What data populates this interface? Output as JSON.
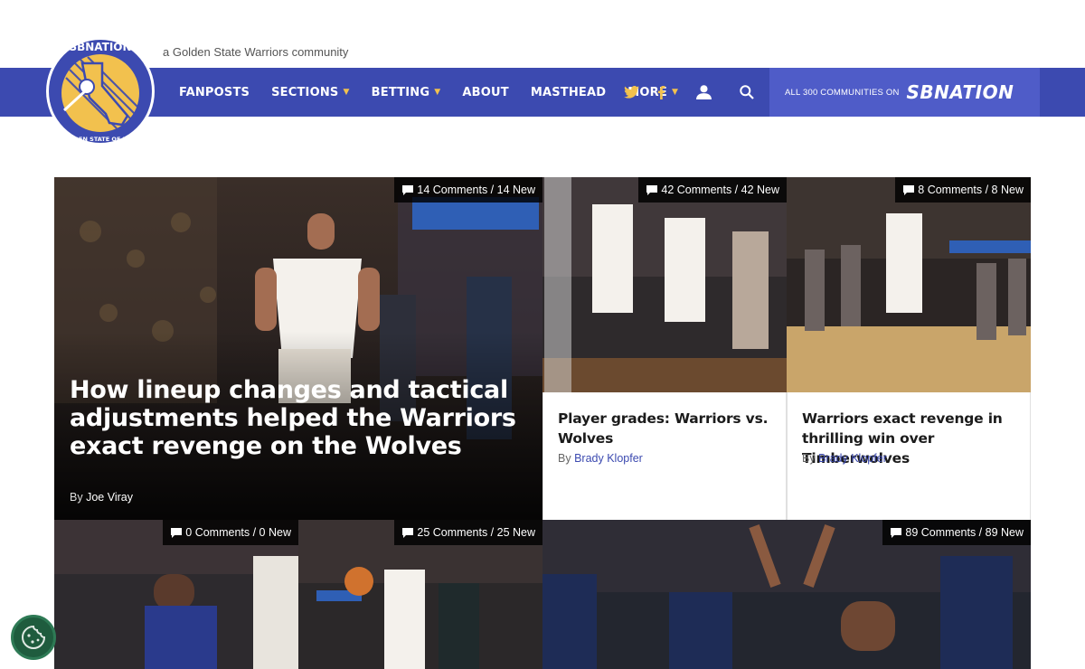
{
  "header": {
    "tagline": "a Golden State Warriors community",
    "logo_text_top": "SBNATION",
    "logo_text_ring": "GOLDEN STATE OF MIND"
  },
  "nav": {
    "items": [
      {
        "label": "FANPOSTS",
        "has_dropdown": false
      },
      {
        "label": "SECTIONS",
        "has_dropdown": true
      },
      {
        "label": "BETTING",
        "has_dropdown": true
      },
      {
        "label": "ABOUT",
        "has_dropdown": false
      },
      {
        "label": "MASTHEAD",
        "has_dropdown": false
      },
      {
        "label": "MORE",
        "has_dropdown": true
      }
    ],
    "all_communities": "ALL 300 COMMUNITIES ON",
    "brand": "SBNATION",
    "icons": [
      "twitter-icon",
      "facebook-icon",
      "user-icon",
      "search-icon"
    ]
  },
  "colors": {
    "nav_bg": "#3c4ab0",
    "brand_bg": "#4f5cc8",
    "accent_gold": "#f2c14e",
    "link_blue": "#3c4ab0"
  },
  "stories": {
    "hero": {
      "comments": "14 Comments / 14 New",
      "title": "How lineup changes and tactical adjustments helped the Warriors exact revenge on the Wolves",
      "by": "By",
      "author": "Joe Viray"
    },
    "card1": {
      "comments": "42 Comments / 42 New",
      "title": "Player grades: Warriors vs. Wolves",
      "by": "By",
      "author": "Brady Klopfer"
    },
    "card2": {
      "comments": "8 Comments / 8 New",
      "title": "Warriors exact revenge in thrilling win over Timberwolves",
      "by": "By",
      "author": "Brady Klopfer"
    },
    "row2": [
      {
        "comments": "0 Comments / 0 New"
      },
      {
        "comments": "25 Comments / 25 New"
      },
      {
        "comments": "89 Comments / 89 New"
      }
    ]
  }
}
